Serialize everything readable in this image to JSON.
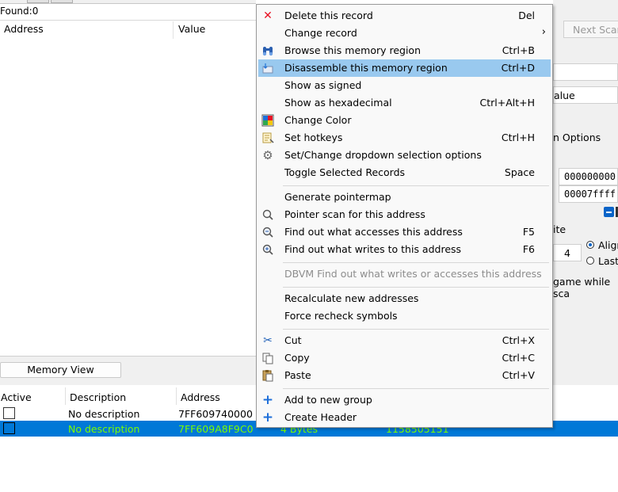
{
  "window": {
    "found_label": "Found:",
    "found_count": "0",
    "columns": {
      "address": "Address",
      "value": "Value"
    },
    "memory_view_button": "Memory View",
    "next_scan_button": "Next Scan",
    "right_panel": {
      "value_label": "alue",
      "scan_options_label": "n Options",
      "start_address": "000000000",
      "stop_address": "00007ffff",
      "writable_label": "ite",
      "alignment_value": "4",
      "align_label": "Align",
      "last_label": "Last",
      "pause_label": "game while sca"
    }
  },
  "address_list": {
    "columns": {
      "active": "Active",
      "description": "Description",
      "address": "Address"
    },
    "rows": [
      {
        "description": "No description",
        "address": "7FF609740000",
        "type": "",
        "value": "",
        "selected": false
      },
      {
        "description": "No description",
        "address": "7FF609A8F9C0",
        "type": "4 Bytes",
        "value": "1158505151",
        "selected": true
      }
    ]
  },
  "context_menu": {
    "items": [
      {
        "label": "Delete this record",
        "shortcut": "Del",
        "icon": "delete-x-icon",
        "disabled": false,
        "highlighted": false
      },
      {
        "label": "Change record",
        "shortcut": "",
        "icon": "",
        "submenu": true,
        "disabled": false,
        "highlighted": false
      },
      {
        "label": "Browse this memory region",
        "shortcut": "Ctrl+B",
        "icon": "binoculars-icon",
        "disabled": false,
        "highlighted": false
      },
      {
        "label": "Disassemble this memory region",
        "shortcut": "Ctrl+D",
        "icon": "disassemble-icon",
        "disabled": false,
        "highlighted": true
      },
      {
        "label": "Show as signed",
        "shortcut": "",
        "icon": "",
        "disabled": false,
        "highlighted": false
      },
      {
        "label": "Show as hexadecimal",
        "shortcut": "Ctrl+Alt+H",
        "icon": "",
        "disabled": false,
        "highlighted": false
      },
      {
        "label": "Change Color",
        "shortcut": "",
        "icon": "color-palette-icon",
        "disabled": false,
        "highlighted": false
      },
      {
        "label": "Set hotkeys",
        "shortcut": "Ctrl+H",
        "icon": "hotkey-icon",
        "disabled": false,
        "highlighted": false
      },
      {
        "label": "Set/Change dropdown selection options",
        "shortcut": "",
        "icon": "gear-icon",
        "disabled": false,
        "highlighted": false
      },
      {
        "label": "Toggle Selected Records",
        "shortcut": "Space",
        "icon": "",
        "disabled": false,
        "highlighted": false
      },
      {
        "label": "Generate pointermap",
        "shortcut": "",
        "icon": "",
        "disabled": false,
        "highlighted": false
      },
      {
        "label": "Pointer scan for this address",
        "shortcut": "",
        "icon": "pointer-scan-icon",
        "disabled": false,
        "highlighted": false
      },
      {
        "label": "Find out what accesses this address",
        "shortcut": "F5",
        "icon": "find-accesses-icon",
        "disabled": false,
        "highlighted": false
      },
      {
        "label": "Find out what writes to this address",
        "shortcut": "F6",
        "icon": "find-writes-icon",
        "disabled": false,
        "highlighted": false
      },
      {
        "label": "DBVM Find out what writes or accesses this address",
        "shortcut": "",
        "icon": "",
        "disabled": true,
        "highlighted": false
      },
      {
        "label": "Recalculate new addresses",
        "shortcut": "",
        "icon": "",
        "disabled": false,
        "highlighted": false
      },
      {
        "label": "Force recheck symbols",
        "shortcut": "",
        "icon": "",
        "disabled": false,
        "highlighted": false
      },
      {
        "label": "Cut",
        "shortcut": "Ctrl+X",
        "icon": "scissors-icon",
        "disabled": false,
        "highlighted": false
      },
      {
        "label": "Copy",
        "shortcut": "Ctrl+C",
        "icon": "copy-icon",
        "disabled": false,
        "highlighted": false
      },
      {
        "label": "Paste",
        "shortcut": "Ctrl+V",
        "icon": "paste-icon",
        "disabled": false,
        "highlighted": false
      },
      {
        "label": "Add to new group",
        "shortcut": "",
        "icon": "plus-icon",
        "disabled": false,
        "highlighted": false
      },
      {
        "label": "Create Header",
        "shortcut": "",
        "icon": "plus-icon",
        "disabled": false,
        "highlighted": false
      }
    ]
  },
  "colors": {
    "menu_highlight": "#99c9ef",
    "selection_row": "#0078d7",
    "selection_text": "#7cfc00",
    "delete_icon": "#e81123",
    "plus_icon": "#1e6fd9"
  }
}
